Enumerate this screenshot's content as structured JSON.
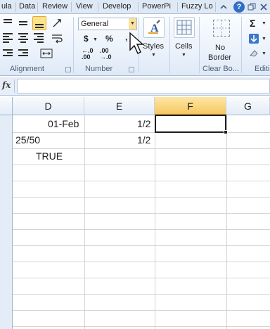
{
  "tabs": [
    "ula",
    "Data",
    "Review",
    "View",
    "Develop",
    "PowerPi",
    "Fuzzy Lo"
  ],
  "tab_icons": {
    "minimize": "chevron-up-icon",
    "help": "?",
    "restore": "window-restore-icon",
    "close": "close-icon"
  },
  "ribbon": {
    "alignment": {
      "label": "Alignment"
    },
    "number": {
      "format_value": "General",
      "currency": "$",
      "percent": "%",
      "comma": ",",
      "increase_decimal": "←.0\n.00",
      "decrease_decimal": ".00\n→.0",
      "label": "Number"
    },
    "styles": {
      "label": "Styles"
    },
    "cells": {
      "label": "Cells"
    },
    "border": {
      "line1": "No",
      "line2": "Border",
      "label": "Clear Bo..."
    },
    "editing": {
      "label": "Editi",
      "sum": "Σ"
    }
  },
  "formula_bar": {
    "fx": "fx",
    "value": ""
  },
  "columns": [
    "D",
    "E",
    "F",
    "G"
  ],
  "selected_column": "F",
  "cells": {
    "d1": "01-Feb",
    "e1": "1/2",
    "d2": "25/50",
    "e2": "1/2",
    "d3": "TRUE"
  },
  "colors": {
    "accent": "#f7c862",
    "ribbon": "#e8f0fa",
    "grid": "#d4d4d4"
  }
}
